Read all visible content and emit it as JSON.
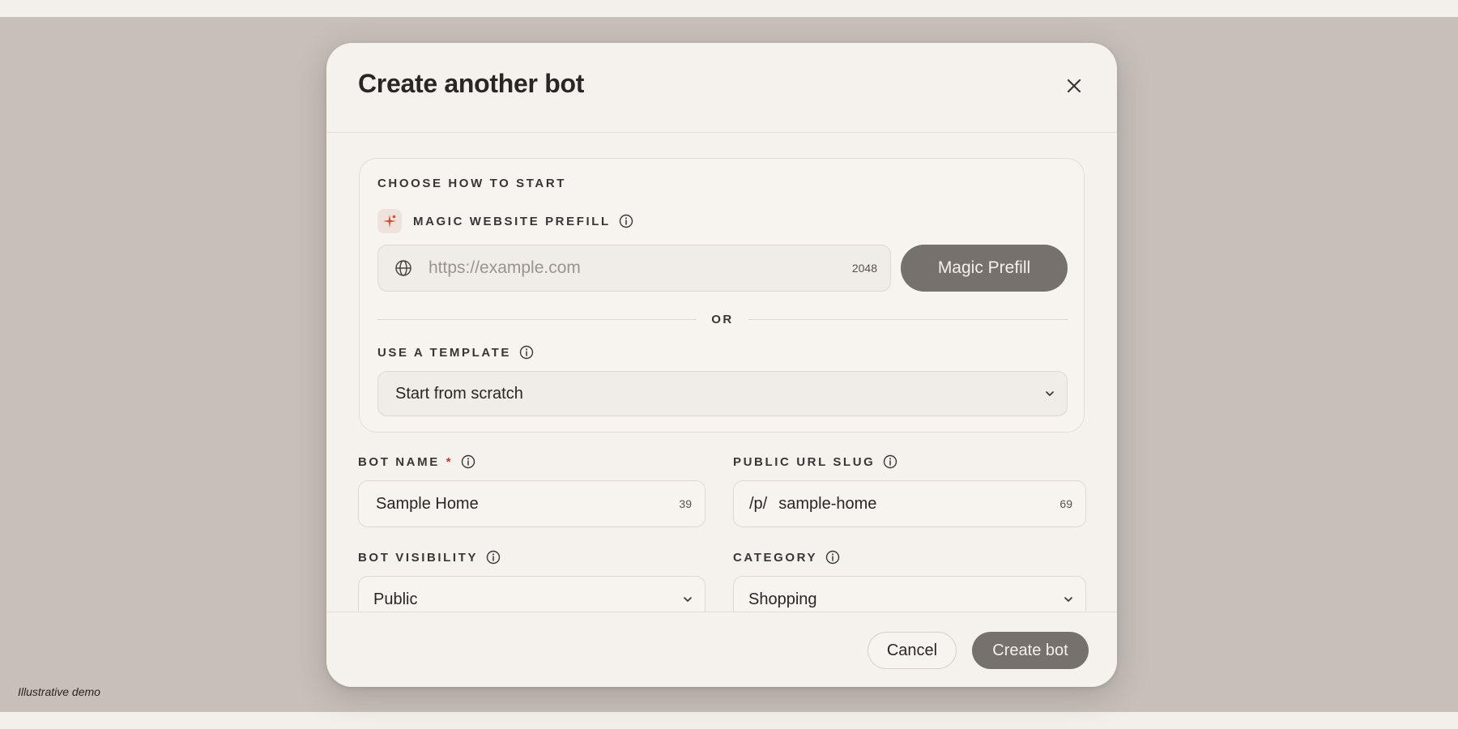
{
  "page": {
    "demo_note": "Illustrative demo"
  },
  "modal": {
    "title": "Create another bot",
    "close_icon": "close-icon"
  },
  "start": {
    "section_label": "CHOOSE HOW TO START",
    "prefill_label": "MAGIC WEBSITE PREFILL",
    "prefill_icon": "sparkle-icon",
    "url_placeholder": "https://example.com",
    "url_value": "",
    "url_counter": "2048",
    "magic_button": "Magic Prefill",
    "or_text": "OR",
    "template_label": "USE A TEMPLATE",
    "template_selected": "Start from scratch"
  },
  "form": {
    "bot_name_label": "BOT NAME",
    "required_mark": "*",
    "bot_name_value": "Sample Home",
    "bot_name_counter": "39",
    "slug_label": "PUBLIC URL SLUG",
    "slug_prefix": "/p/",
    "slug_value": "sample-home",
    "slug_counter": "69",
    "visibility_label": "BOT VISIBILITY",
    "visibility_selected": "Public",
    "category_label": "CATEGORY",
    "category_selected": "Shopping"
  },
  "footer": {
    "cancel_label": "Cancel",
    "create_label": "Create bot"
  },
  "colors": {
    "backdrop": "#c7bfba",
    "modal_bg": "#f5f2ee",
    "primary_button": "#77716d",
    "required": "#c0392b",
    "sparkle": "#c8553a"
  }
}
